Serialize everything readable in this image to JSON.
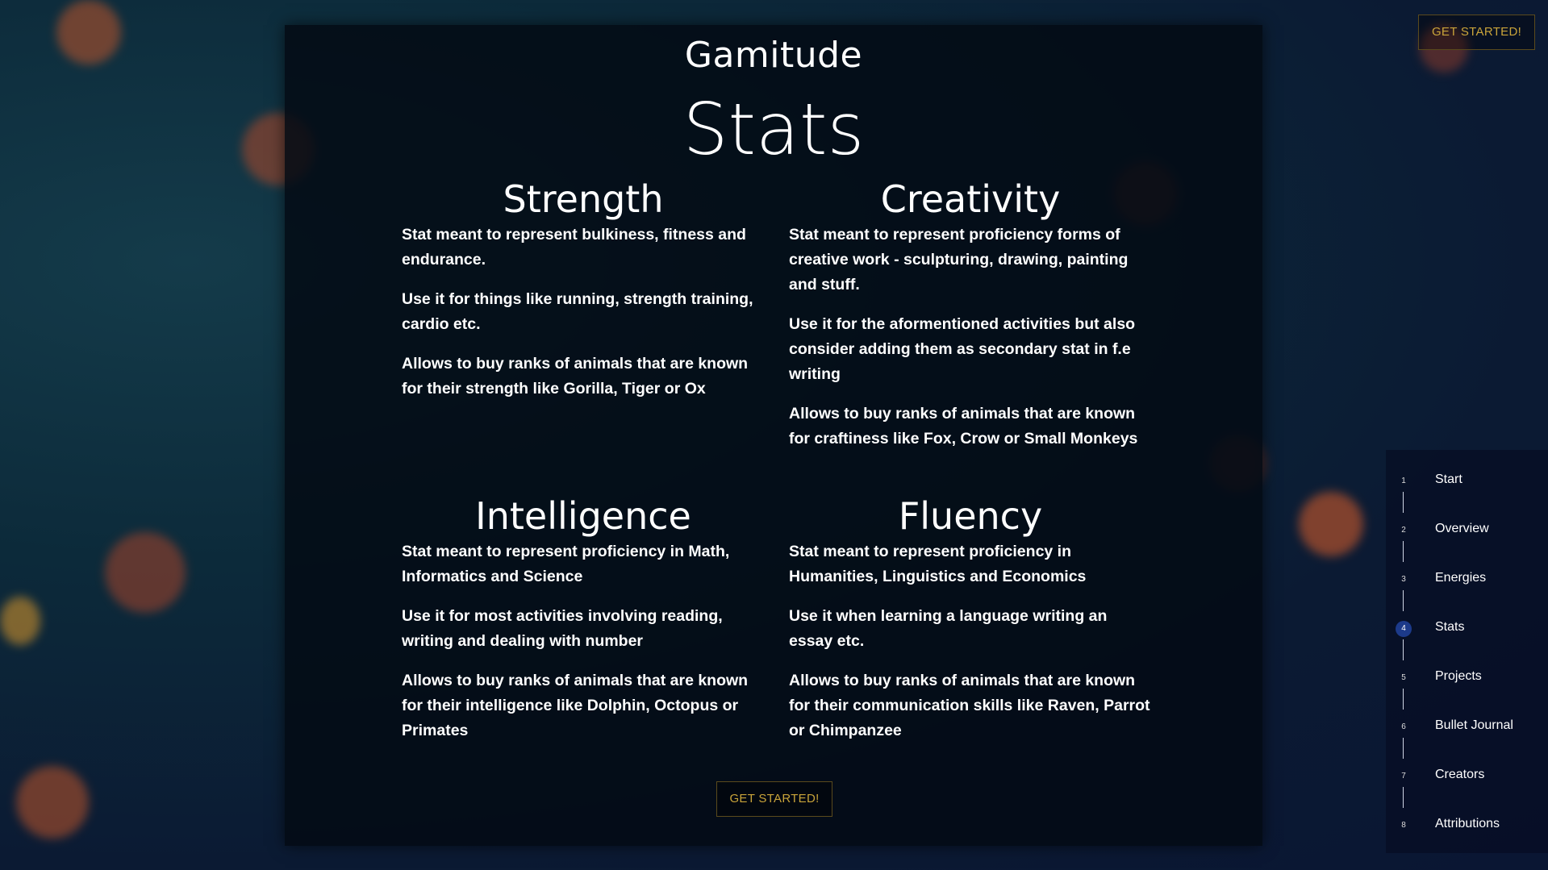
{
  "brand": "Gamitude",
  "page_title": "Stats",
  "cta_label": "GET STARTED!",
  "stats": [
    {
      "name": "Strength",
      "paragraphs": [
        "Stat meant to represent bulkiness, fitness and endurance.",
        "Use it for things like running, strength training, cardio etc.",
        "Allows to buy ranks of animals that are known for their strength like Gorilla, Tiger or Ox"
      ]
    },
    {
      "name": "Creativity",
      "paragraphs": [
        "Stat meant to represent proficiency forms of creative work - sculpturing, drawing, painting and stuff.",
        "Use it for the aformentioned activities but also consider adding them as secondary stat in f.e writing",
        "Allows to buy ranks of animals that are known for craftiness like Fox, Crow or Small Monkeys"
      ]
    },
    {
      "name": "Intelligence",
      "paragraphs": [
        "Stat meant to represent proficiency in Math, Informatics and Science",
        "Use it for most activities involving reading, writing and dealing with number",
        "Allows to buy ranks of animals that are known for their intelligence like Dolphin, Octopus or Primates"
      ]
    },
    {
      "name": "Fluency",
      "paragraphs": [
        "Stat meant to represent proficiency in Humanities, Linguistics and Economics",
        "Use it when learning a language writing an essay etc.",
        "Allows to buy ranks of animals that are known for their communication skills like Raven, Parrot or Chimpanzee"
      ]
    }
  ],
  "nav": {
    "active_index": 3,
    "items": [
      {
        "num": "1",
        "label": "Start"
      },
      {
        "num": "2",
        "label": "Overview"
      },
      {
        "num": "3",
        "label": "Energies"
      },
      {
        "num": "4",
        "label": "Stats"
      },
      {
        "num": "5",
        "label": "Projects"
      },
      {
        "num": "6",
        "label": "Bullet Journal"
      },
      {
        "num": "7",
        "label": "Creators"
      },
      {
        "num": "8",
        "label": "Attributions"
      }
    ]
  },
  "colors": {
    "accent_gold": "#c9a43a",
    "active_nav": "#1c3a8a"
  }
}
